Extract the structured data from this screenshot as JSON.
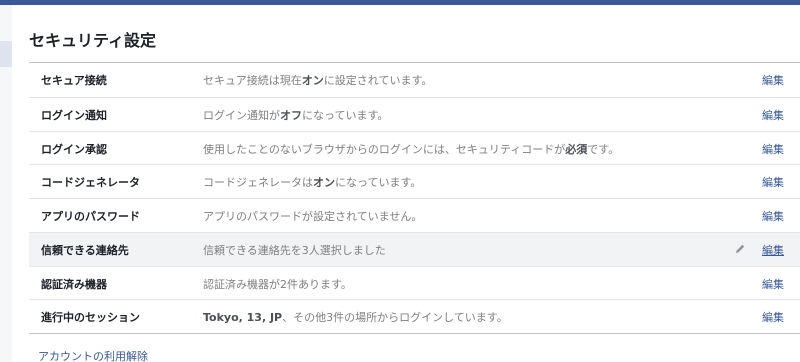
{
  "page": {
    "title": "セキュリティ設定"
  },
  "rows": [
    {
      "label": "セキュア接続",
      "parts": [
        [
          "セキュア接続は現在",
          false
        ],
        [
          "オン",
          true
        ],
        [
          "に設定されています。",
          false
        ]
      ],
      "edit": "編集"
    },
    {
      "label": "ログイン通知",
      "parts": [
        [
          "ログイン通知が",
          false
        ],
        [
          "オフ",
          true
        ],
        [
          "になっています。",
          false
        ]
      ],
      "edit": "編集"
    },
    {
      "label": "ログイン承認",
      "parts": [
        [
          "使用したことのないブラウザからのログインには、セキュリティコードが",
          false
        ],
        [
          "必須",
          true
        ],
        [
          "です。",
          false
        ]
      ],
      "edit": "編集"
    },
    {
      "label": "コードジェネレータ",
      "parts": [
        [
          "コードジェネレータは",
          false
        ],
        [
          "オン",
          true
        ],
        [
          "になっています。",
          false
        ]
      ],
      "edit": "編集"
    },
    {
      "label": "アプリのパスワード",
      "parts": [
        [
          "アプリのパスワードが設定されていません。",
          false
        ]
      ],
      "edit": "編集"
    },
    {
      "label": "信頼できる連絡先",
      "parts": [
        [
          "信頼できる連絡先を3人選択しました",
          false
        ]
      ],
      "edit": "編集",
      "hover": true
    },
    {
      "label": "認証済み機器",
      "parts": [
        [
          "認証済み機器が2件あります。",
          false
        ]
      ],
      "edit": "編集"
    },
    {
      "label": "進行中のセッション",
      "parts": [
        [
          "Tokyo, 13, JP",
          true
        ],
        [
          "、その他3件の場所からログインしています。",
          false
        ]
      ],
      "edit": "編集"
    }
  ],
  "footer": {
    "deactivate_link": "アカウントの利用解除"
  },
  "icons": {
    "edit_hover": "pencil-icon"
  },
  "colors": {
    "brand": "#3b5998",
    "link": "#365899"
  }
}
